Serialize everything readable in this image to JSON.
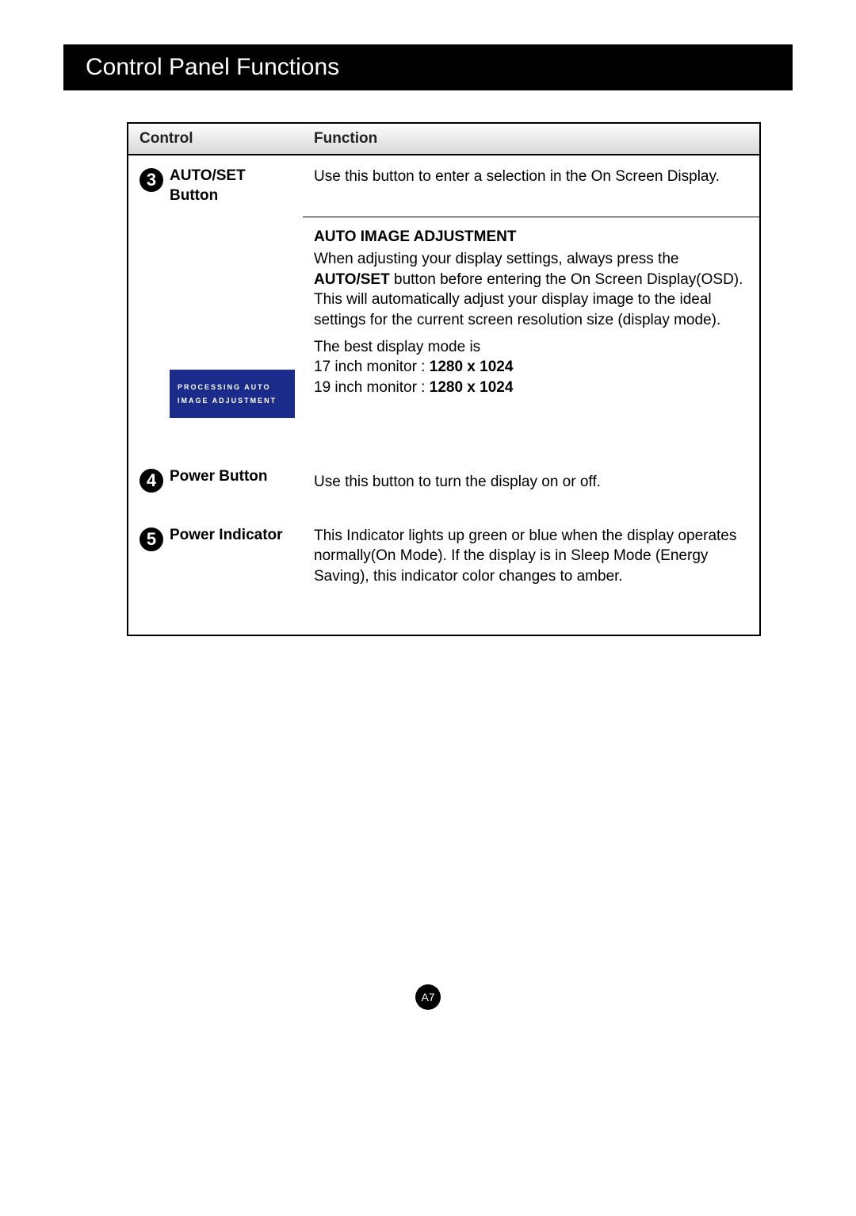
{
  "header": {
    "title": "Control Panel Functions"
  },
  "table": {
    "columns": {
      "control": "Control",
      "function": "Function"
    },
    "rows": [
      {
        "num": "3",
        "control_line1": "AUTO/SET",
        "control_line2": "Button",
        "function_text": "Use this button to enter a selection in the On Screen Display."
      },
      {
        "section_title": "AUTO IMAGE ADJUSTMENT",
        "body_pre": "When adjusting your display settings, always press the ",
        "body_bold": "AUTO/SET",
        "body_post": " button before entering the On Screen Display(OSD). This will automatically adjust your display image to the ideal settings for the current screen resolution size (display mode).",
        "mode_intro": "The best display mode is",
        "mode_17_pre": "17 inch monitor : ",
        "mode_17_val": "1280 x 1024",
        "mode_19_pre": "19 inch monitor : ",
        "mode_19_val": "1280 x 1024",
        "processing_line1": "PROCESSING AUTO",
        "processing_line2": "IMAGE ADJUSTMENT"
      },
      {
        "num": "4",
        "control_label": "Power Button",
        "function_text": "Use this button to turn the display on or off."
      },
      {
        "num": "5",
        "control_label": "Power Indicator",
        "function_text": "This Indicator lights up green or blue when the display operates normally(On Mode). If the display is in Sleep Mode (Energy Saving), this indicator color changes to amber."
      }
    ]
  },
  "page_number": "A7"
}
